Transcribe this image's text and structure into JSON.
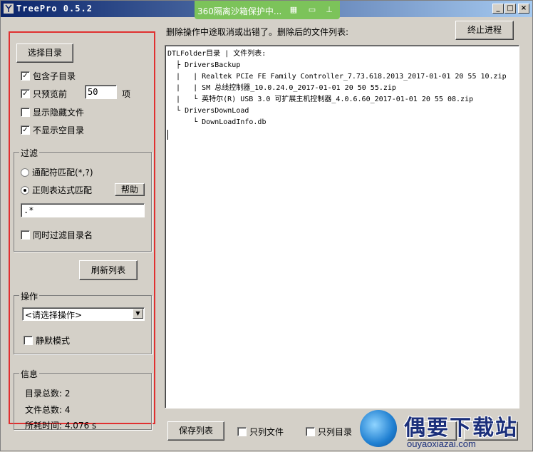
{
  "window": {
    "title": "TreePro 0.5.2"
  },
  "sandbox_banner": {
    "text": "360隔离沙箱保护中..."
  },
  "left": {
    "select_dir_label": "选择目录",
    "include_subdirs": {
      "label": "包含子目录",
      "checked": true
    },
    "preview_only": {
      "label": "只预览前",
      "value": "50",
      "unit": "项",
      "checked": true
    },
    "show_hidden": {
      "label": "显示隐藏文件",
      "checked": false
    },
    "hide_empty": {
      "label": "不显示空目录",
      "checked": true
    },
    "filter": {
      "title": "过滤",
      "wildcard_label": "通配符匹配(*,?)",
      "regex_label": "正则表达式匹配",
      "selected": "regex",
      "help_label": "帮助",
      "pattern_value": ".*",
      "filter_dirs": {
        "label": "同时过滤目录名",
        "checked": false
      }
    },
    "refresh_label": "刷新列表",
    "ops": {
      "title": "操作",
      "select_value": "<请选择操作>",
      "silent": {
        "label": "静默模式",
        "checked": false
      }
    },
    "info": {
      "title": "信息",
      "dir_count": "目录总数: 2",
      "file_count": "文件总数: 4",
      "time_used": "所耗时间: 4.076 s"
    }
  },
  "right": {
    "status_text": "删除操作中途取消或出错了。删除后的文件列表:",
    "stop_label": "终止进程",
    "tree_lines": [
      "DTLFolder目录 | 文件列表:",
      "  ├ DriversBackup",
      "  |   | Realtek PCIe FE Family Controller_7.73.618.2013_2017-01-01 20 55 10.zip",
      "  |   | SM 总线控制器_10.0.24.0_2017-01-01 20 50 55.zip",
      "  |   └ 英特尔(R) USB 3.0 可扩展主机控制器_4.0.6.60_2017-01-01 20 55 08.zip",
      "  └ DriversDownLoad",
      "      └ DownLoadInfo.db"
    ],
    "save_label": "保存列表",
    "files_only": {
      "label": "只列文件",
      "checked": false
    },
    "dirs_only": {
      "label": "只列目录",
      "checked": false
    }
  },
  "watermark": {
    "brand": "偶要下载站",
    "url": "ouyaoxiazai.com"
  },
  "colors": {
    "highlight_frame": "#e03030",
    "title_bar": "#0a246a",
    "sandbox": "#7cc35a"
  }
}
